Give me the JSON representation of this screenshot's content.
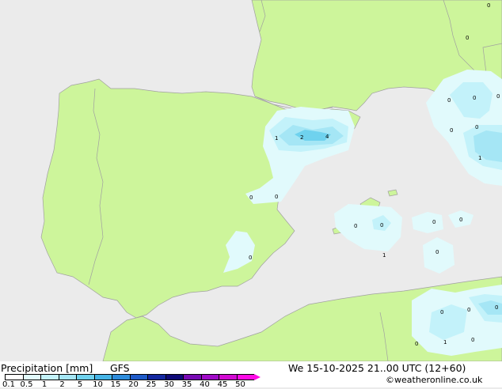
{
  "footer": {
    "title": "Precipitation [mm]",
    "model": "GFS",
    "datetime": "We 15-10-2025 21..00 UTC (12+60)",
    "credit": "©weatheronline.co.uk"
  },
  "legend": {
    "labels": [
      "0.1",
      "0.5",
      "1",
      "2",
      "5",
      "10",
      "15",
      "20",
      "25",
      "30",
      "35",
      "40",
      "45",
      "50"
    ],
    "colors": [
      "#ffffff",
      "#e1fafc",
      "#c3f2fa",
      "#a5e6f5",
      "#6fd2ee",
      "#46b4e6",
      "#2d8cdc",
      "#1e5ac8",
      "#1428a0",
      "#0f0a78",
      "#780ab4",
      "#a00ac8",
      "#d20ad2",
      "#ff0ae6"
    ]
  },
  "colors": {
    "sea": "#ebebeb",
    "land_domain": "#cdf59b",
    "land_outside": "#ebebeb",
    "border": "#a0a0a0"
  },
  "map": {
    "values": [
      {
        "label": "0",
        "id": "v1"
      },
      {
        "label": "0",
        "id": "v2"
      },
      {
        "label": "1",
        "id": "v3"
      },
      {
        "label": "2",
        "id": "v4"
      },
      {
        "label": "4",
        "id": "v5"
      },
      {
        "label": "0",
        "id": "v6"
      },
      {
        "label": "0",
        "id": "v7"
      },
      {
        "label": "0",
        "id": "v8"
      },
      {
        "label": "0",
        "id": "v9"
      },
      {
        "label": "0",
        "id": "v10"
      },
      {
        "label": "0",
        "id": "v11"
      },
      {
        "label": "0",
        "id": "v12"
      },
      {
        "label": "0",
        "id": "v13"
      },
      {
        "label": "1",
        "id": "v14"
      },
      {
        "label": "0",
        "id": "v15"
      },
      {
        "label": "0",
        "id": "v16"
      },
      {
        "label": "0",
        "id": "v17"
      },
      {
        "label": "0",
        "id": "v18"
      },
      {
        "label": "1",
        "id": "v19"
      },
      {
        "label": "0",
        "id": "v20"
      },
      {
        "label": "0",
        "id": "v21"
      },
      {
        "label": "0",
        "id": "v22"
      },
      {
        "label": "0",
        "id": "v23"
      },
      {
        "label": "0",
        "id": "v24"
      },
      {
        "label": "1",
        "id": "v25"
      },
      {
        "label": "0",
        "id": "v26"
      },
      {
        "label": "0",
        "id": "v27"
      },
      {
        "label": "1",
        "id": "v28"
      },
      {
        "label": "0",
        "id": "v29"
      }
    ]
  }
}
